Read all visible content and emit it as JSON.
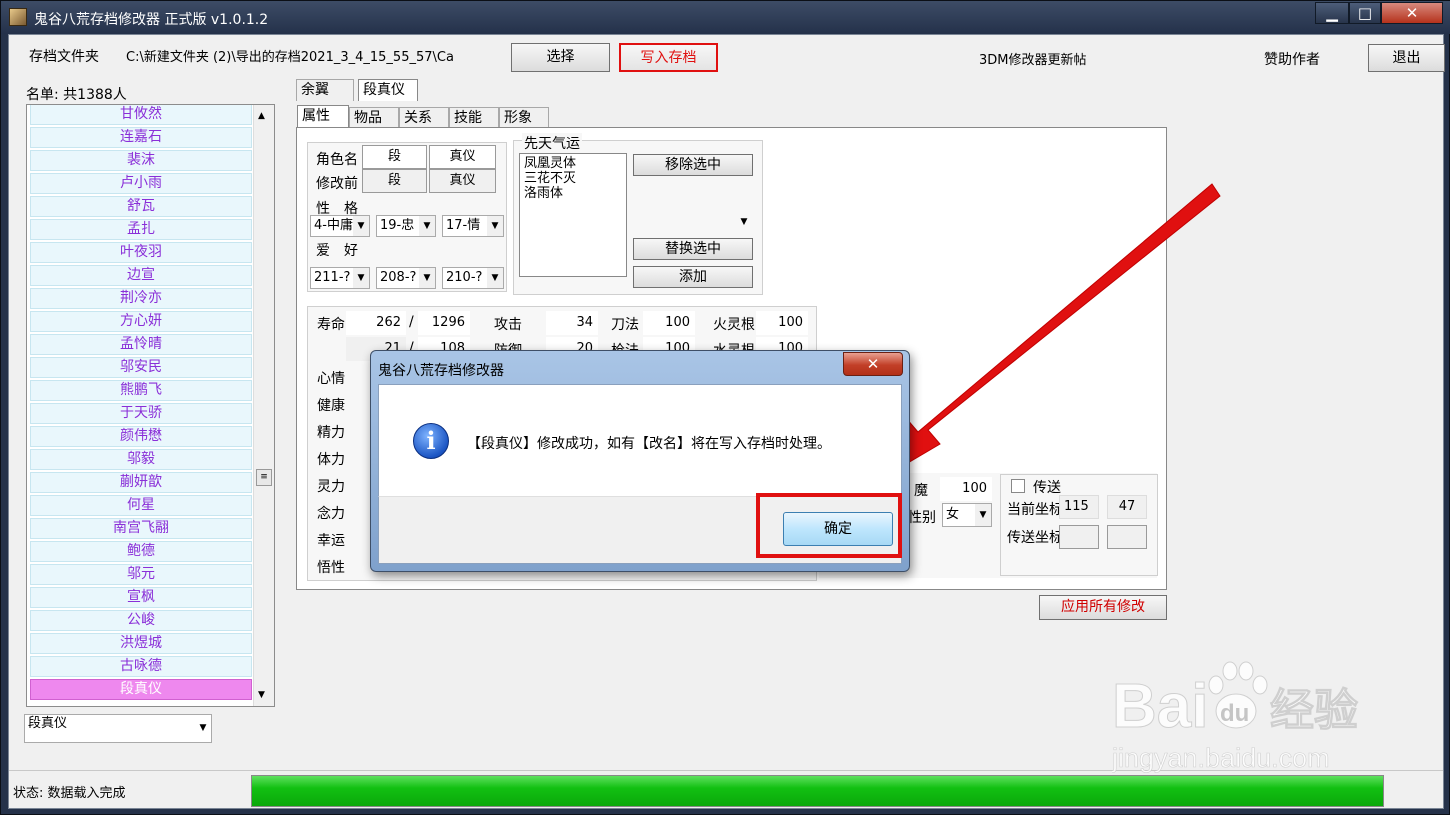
{
  "window": {
    "title": "鬼谷八荒存档修改器 正式版 v1.0.1.2",
    "min": "▁",
    "max": "□",
    "close": "✕"
  },
  "header": {
    "save_label": "存档文件夹",
    "save_path": "C:\\新建文件夹 (2)\\导出的存档2021_3_4_15_55_57\\Ca",
    "select_btn": "选择",
    "write_btn": "写入存档",
    "update_link": "3DM修改器更新帖",
    "sponsor": "赞助作者",
    "exit_btn": "退出"
  },
  "list": {
    "count_label": "名单: 共1388人",
    "items": [
      "甘攸然",
      "连嘉石",
      "裴沫",
      "卢小雨",
      "舒瓦",
      "孟扎",
      "叶夜羽",
      "边宣",
      "荆冷亦",
      "方心妍",
      "孟怜晴",
      "邬安民",
      "熊鹏飞",
      "于天骄",
      "颜伟懋",
      "邬毅",
      "蒯妍歆",
      "何星",
      "南宫飞翮",
      "鲍德",
      "邬元",
      "宣枫",
      "公峻",
      "洪煜城",
      "古咏德",
      "段真仪"
    ],
    "selected": "段真仪",
    "combo_value": "段真仪"
  },
  "char_tabs": [
    "余翼",
    "段真仪"
  ],
  "sub_tabs": [
    "属性",
    "物品",
    "关系",
    "技能",
    "形象"
  ],
  "attr": {
    "name_label": "角色名",
    "name_values": [
      "段",
      "真仪"
    ],
    "before_label": "修改前",
    "before_values": [
      "段",
      "真仪"
    ],
    "personality_label": "性　格",
    "personality": [
      "4-中庸",
      "19-忠",
      "17-情"
    ],
    "hobby_label": "爱　好",
    "hobby": [
      "211-?",
      "208-?",
      "210-?"
    ]
  },
  "luck": {
    "title": "先天气运",
    "items": [
      "凤凰灵体",
      "三花不灭",
      "洛雨体"
    ],
    "remove_btn": "移除选中",
    "replace_btn": "替换选中",
    "add_btn": "添加"
  },
  "stats": {
    "life_label": "寿命",
    "life": "262",
    "sep": "/",
    "life_max": "1296",
    "row2": "21",
    "row2_max": "108",
    "attack_label": "攻击",
    "attack": "34",
    "defense_label": "防御",
    "defense": "20",
    "sword_label": "刀法",
    "sword": "100",
    "spear_label": "枪法",
    "spear": "100",
    "fire_label": "火灵根",
    "fire": "100",
    "water_label": "水灵根",
    "water": "100",
    "left_labels": [
      "心情",
      "健康",
      "精力",
      "体力",
      "灵力",
      "念力",
      "幸运",
      "悟性"
    ],
    "demon_label": "魔",
    "demon": "100",
    "gender_label": "性别",
    "gender": "女"
  },
  "teleport": {
    "checkbox_label": "传送",
    "current_label": "当前坐标",
    "current_x": "115",
    "current_y": "47",
    "target_label": "传送坐标"
  },
  "apply_btn": "应用所有修改",
  "status": {
    "text": "状态: 数据载入完成",
    "progress": 1.0
  },
  "dialog": {
    "title": "鬼谷八荒存档修改器",
    "message": "【段真仪】修改成功，如有【改名】将在写入存档时处理。",
    "ok": "确定",
    "close": "✕"
  },
  "watermark": {
    "brand": "Bai",
    "brand2": "du",
    "cn": "经验",
    "url": "jingyan.baidu.com"
  },
  "colors": {
    "arrow": "#e01010",
    "progress": "#12c012",
    "list_text": "#8a2fd8",
    "list_selected": "#ee88ee"
  }
}
